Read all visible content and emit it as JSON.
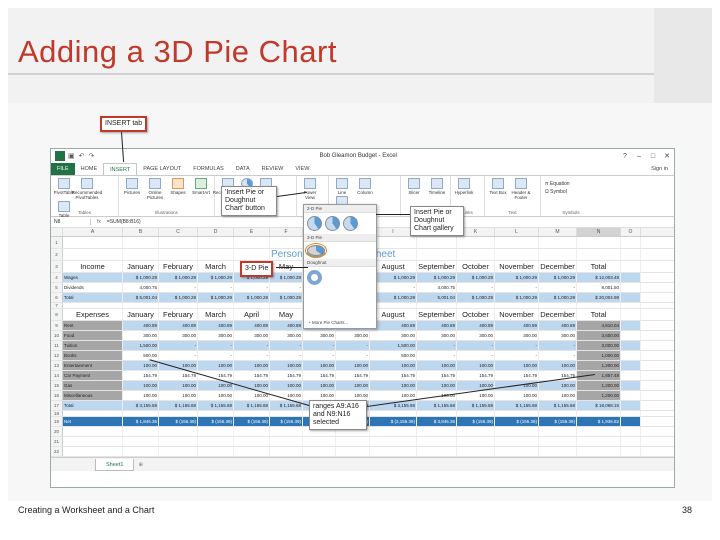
{
  "slide": {
    "title": "Adding a 3D Pie Chart",
    "footer": "Creating a Worksheet and a Chart",
    "page_number": "38"
  },
  "excel": {
    "document_title": "Bob Gleamon Budget - Excel",
    "signin": "Sign in",
    "tabs": [
      "FILE",
      "HOME",
      "INSERT",
      "PAGE LAYOUT",
      "FORMULAS",
      "DATA",
      "REVIEW",
      "VIEW"
    ],
    "active_tab": "INSERT",
    "ribbon_buttons": [
      {
        "label": "PivotTable",
        "group": "Tables"
      },
      {
        "label": "Recommended PivotTables",
        "group": "Tables"
      },
      {
        "label": "Table",
        "group": "Tables"
      },
      {
        "label": "Pictures",
        "group": "Illustrations"
      },
      {
        "label": "Online Pictures",
        "group": "Illustrations"
      },
      {
        "label": "Shapes",
        "group": "Illustrations"
      },
      {
        "label": "SmartArt",
        "group": "Illustrations"
      },
      {
        "label": "Screenshot",
        "group": "Illustrations"
      },
      {
        "label": "Recommended Charts",
        "group": "Charts"
      },
      {
        "label": "PivotChart",
        "group": "Charts"
      },
      {
        "label": "Power View",
        "group": "Reports"
      },
      {
        "label": "Line",
        "group": "Sparklines"
      },
      {
        "label": "Column",
        "group": "Sparklines"
      },
      {
        "label": "Win/Loss",
        "group": "Sparklines"
      },
      {
        "label": "Slicer",
        "group": "Filters"
      },
      {
        "label": "Timeline",
        "group": "Filters"
      },
      {
        "label": "Hyperlink",
        "group": "Links"
      },
      {
        "label": "Text Box",
        "group": "Text"
      },
      {
        "label": "Header & Footer",
        "group": "Text"
      }
    ],
    "group_labels": [
      "Tables",
      "Illustrations",
      "Charts",
      "Reports",
      "Sparklines",
      "Filters",
      "Links",
      "Text",
      "Symbols"
    ],
    "symbols": [
      "Equation",
      "Symbol"
    ],
    "name_box": "N8",
    "formula_content": "=SUM(B8:B16)",
    "column_headers": [
      "A",
      "B",
      "C",
      "D",
      "E",
      "F",
      "G",
      "H",
      "I",
      "J",
      "K",
      "L",
      "M",
      "N",
      "O"
    ],
    "sheet_title": "Personal Budget Worksheet",
    "income_header": [
      "Income",
      "January",
      "February",
      "March",
      "April",
      "May",
      "June",
      "July",
      "August",
      "September",
      "October",
      "November",
      "December",
      "Total"
    ],
    "income_rows": [
      {
        "label": "Wages",
        "values": [
          "$ 1,000.29",
          "$ 1,000.29",
          "$ 1,000.29",
          "$ 1,000.29",
          "$ 1,000.29",
          "$ 1,000.29",
          "$ 1,000.29",
          "$ 1,000.29",
          "$ 1,000.29",
          "$ 1,000.29",
          "$ 1,000.29",
          "$ 1,000.29",
          "$ 12,003.48"
        ]
      },
      {
        "label": "Dividends",
        "values": [
          "4,000.75",
          "-",
          "-",
          "-",
          "-",
          "-",
          "-",
          "-",
          "4,000.75",
          "-",
          "-",
          "-",
          "8,001.50"
        ]
      },
      {
        "label": "Total",
        "values": [
          "$ 5,001.04",
          "$ 1,000.29",
          "$ 1,000.29",
          "$ 1,000.29",
          "$ 1,000.29",
          "$ 1,000.29",
          "$ 1,000.29",
          "$ 1,000.29",
          "5,001.04",
          "$ 1,000.29",
          "$ 1,000.29",
          "$ 1,000.29",
          "$ 20,004.98"
        ]
      }
    ],
    "expense_header": [
      "Expenses",
      "January",
      "February",
      "March",
      "April",
      "May",
      "June",
      "July",
      "August",
      "September",
      "October",
      "November",
      "December",
      "Total"
    ],
    "expense_rows": [
      {
        "label": "Rent",
        "values": [
          "400.89",
          "400.89",
          "400.89",
          "400.89",
          "400.89",
          "400.89",
          "400.89",
          "400.89",
          "400.89",
          "400.89",
          "400.89",
          "400.89",
          "4,810.04"
        ]
      },
      {
        "label": "Food",
        "values": [
          "300.00",
          "300.00",
          "300.00",
          "300.00",
          "300.00",
          "300.00",
          "300.00",
          "300.00",
          "300.00",
          "300.00",
          "300.00",
          "300.00",
          "3,600.00"
        ]
      },
      {
        "label": "Tuition",
        "values": [
          "1,500.00",
          "-",
          "-",
          "-",
          "-",
          "-",
          "-",
          "1,500.00",
          "-",
          "-",
          "-",
          "-",
          "3,000.00"
        ]
      },
      {
        "label": "Books",
        "values": [
          "500.00",
          "-",
          "-",
          "-",
          "-",
          "-",
          "-",
          "500.00",
          "-",
          "-",
          "-",
          "-",
          "1,000.00"
        ]
      },
      {
        "label": "Entertainment",
        "values": [
          "100.00",
          "100.00",
          "100.00",
          "100.00",
          "100.00",
          "100.00",
          "100.00",
          "100.00",
          "100.00",
          "100.00",
          "100.00",
          "100.00",
          "1,200.00"
        ]
      },
      {
        "label": "Car Payment",
        "values": [
          "154.79",
          "154.79",
          "154.79",
          "154.79",
          "154.79",
          "154.79",
          "154.79",
          "154.79",
          "154.79",
          "154.79",
          "154.79",
          "154.79",
          "1,857.48"
        ]
      },
      {
        "label": "Gas",
        "values": [
          "100.00",
          "100.00",
          "100.00",
          "100.00",
          "100.00",
          "100.00",
          "100.00",
          "100.00",
          "100.00",
          "100.00",
          "100.00",
          "100.00",
          "1,200.00"
        ]
      },
      {
        "label": "Miscellaneous",
        "values": [
          "100.00",
          "100.00",
          "100.00",
          "100.00",
          "100.00",
          "100.00",
          "100.00",
          "100.00",
          "100.00",
          "100.00",
          "100.00",
          "100.00",
          "1,200.00"
        ]
      },
      {
        "label": "Total",
        "values": [
          "$ 3,155.68",
          "$ 1,155.68",
          "$ 1,155.68",
          "$ 1,155.68",
          "$ 1,155.68",
          "$ 1,155.68",
          "$ 1,155.68",
          "$ 3,155.68",
          "$ 1,155.68",
          "$ 1,155.68",
          "$ 1,155.68",
          "$ 1,155.68",
          "$ 18,068.16"
        ]
      }
    ],
    "net_row": {
      "label": "Net",
      "values": [
        "$ 1,845.36",
        "$ (155.39)",
        "$ (155.39)",
        "$ (155.39)",
        "$ (155.39)",
        "$ (155.39)",
        "$ (155.39)",
        "$ (2,155.39)",
        "$ 3,845.36",
        "$ (155.39)",
        "$ (155.39)",
        "$ (155.39)",
        "$ 1,936.82"
      ]
    },
    "sheet_tab": "Sheet1",
    "gallery": {
      "section_2d": "2-D Pie",
      "section_3d": "3-D Pie",
      "section_doughnut": "Doughnut",
      "more": "More Pie Charts..."
    }
  },
  "callouts": {
    "insert_tab": "INSERT tab",
    "insert_pie_button": "'Insert Pie or Doughnut Chart' button",
    "insert_pie_gallery": "Insert Pie or Doughnut Chart gallery",
    "pie_3d": "3-D Pie",
    "ranges_selected": "ranges A9:A16 and N9:N16 selected"
  }
}
